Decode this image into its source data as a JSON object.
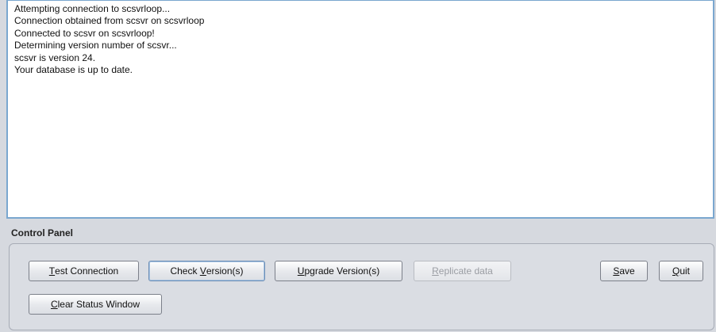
{
  "status_window": {
    "lines": [
      "Attempting connection to scsvrloop...",
      "Connection obtained from scsvr on scsvrloop",
      "Connected to scsvr on scsvrloop!",
      "Determining version number of scsvr...",
      "scsvr is version 24.",
      "Your database is up to date."
    ]
  },
  "control_panel": {
    "title": "Control Panel",
    "buttons": {
      "test_connection": {
        "mnemonic": "T",
        "rest": "est Connection"
      },
      "check_version": {
        "pre": "Check ",
        "mnemonic": "V",
        "rest": "ersion(s)"
      },
      "upgrade_version": {
        "mnemonic": "U",
        "rest": "pgrade Version(s)"
      },
      "replicate_data": {
        "mnemonic": "R",
        "rest": "eplicate data"
      },
      "save": {
        "mnemonic": "S",
        "rest": "ave"
      },
      "quit": {
        "mnemonic": "Q",
        "rest": "uit"
      },
      "clear_status": {
        "mnemonic": "C",
        "rest": "lear Status Window"
      }
    }
  }
}
